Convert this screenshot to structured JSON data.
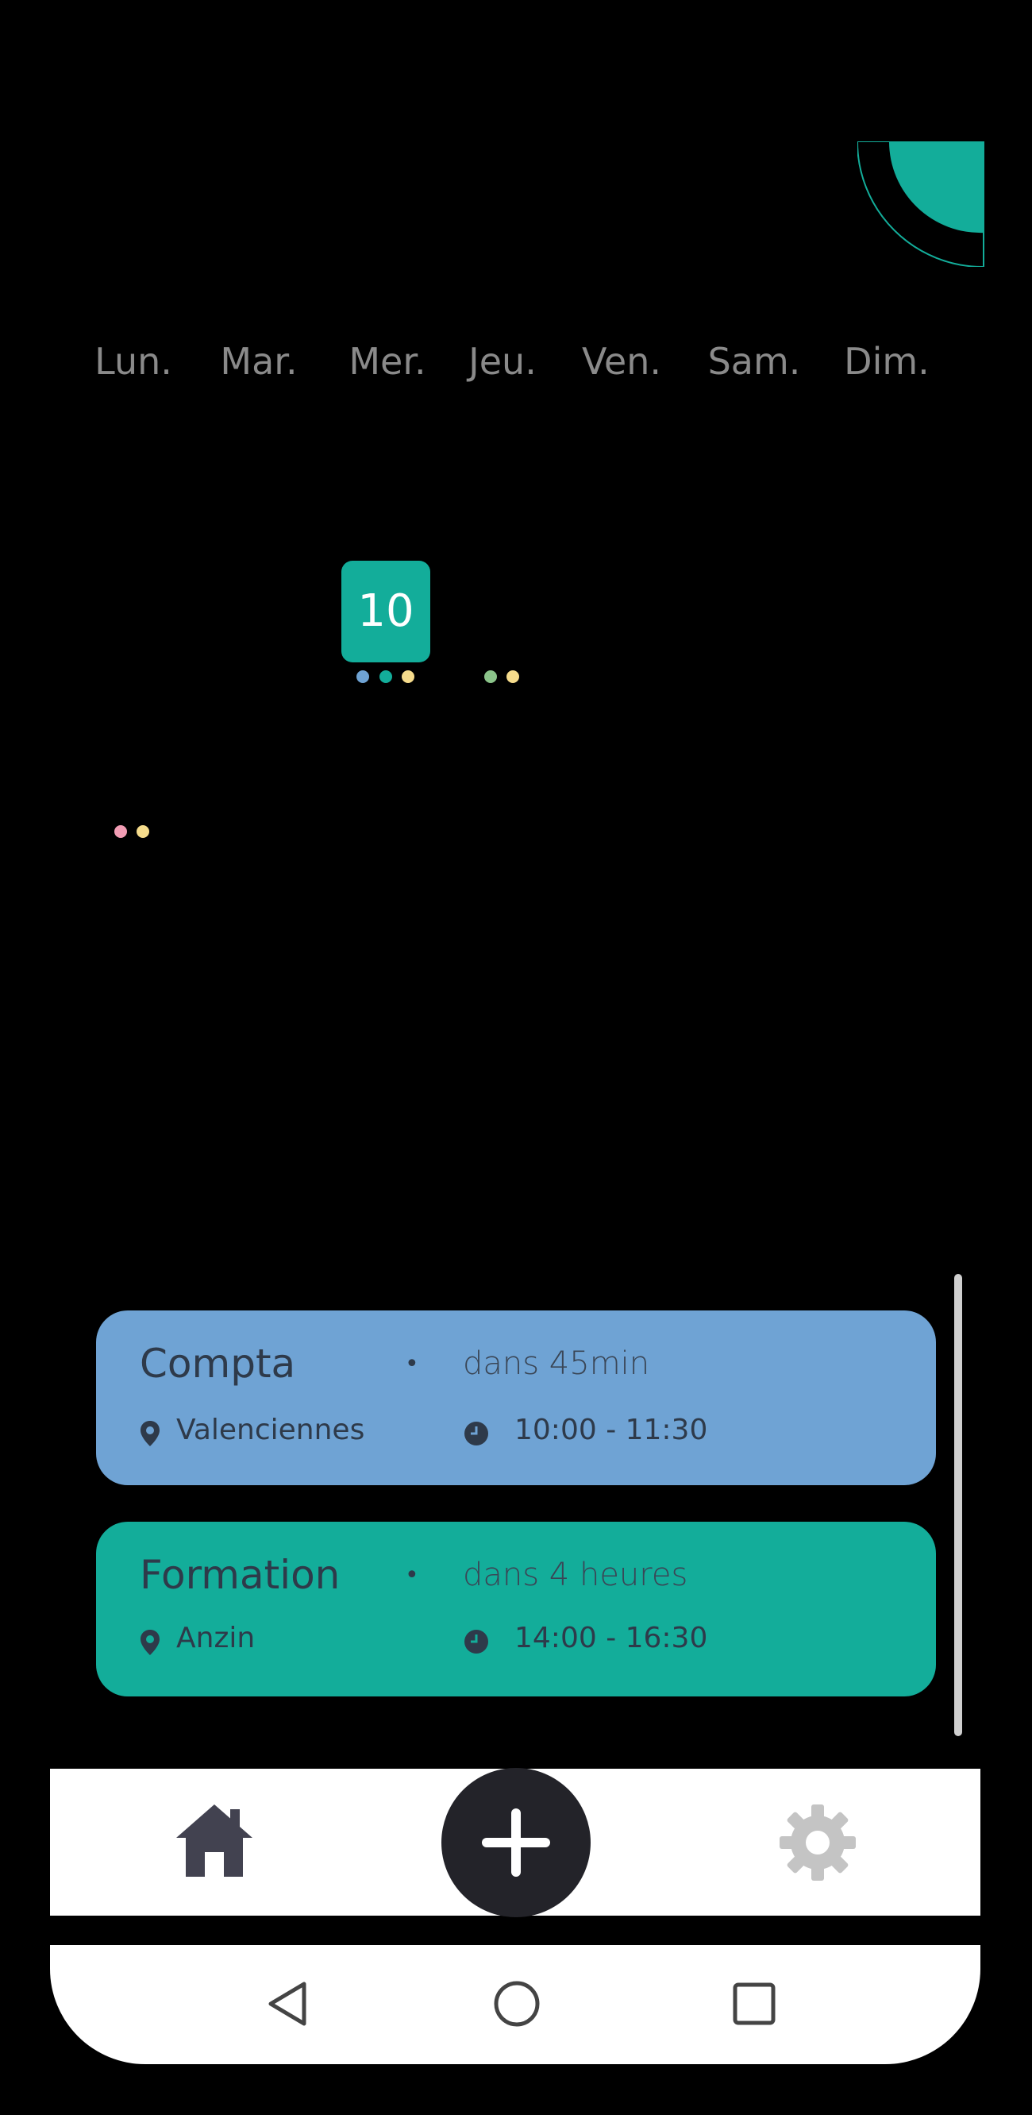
{
  "calendar": {
    "weekdays": [
      "Lun.",
      "Mar.",
      "Mer.",
      "Jeu.",
      "Ven.",
      "Sam.",
      "Dim."
    ],
    "selected_day": "10",
    "dot_colors": {
      "blue": "#6fa3d4",
      "teal": "#13ad9a",
      "yellow": "#f6dc8c",
      "green": "#8bc48a",
      "pink": "#f29db4"
    }
  },
  "events": [
    {
      "title": "Compta",
      "separator": "•",
      "when": "dans 45min",
      "location": "Valenciennes",
      "time": "10:00 - 11:30",
      "color": "#6fa3d4"
    },
    {
      "title": "Formation",
      "separator": "•",
      "when": "dans 4 heures",
      "location": "Anzin",
      "time": "14:00 - 16:30",
      "color": "#13ad9a"
    }
  ],
  "nav": {
    "home_icon": "home-icon",
    "add_icon": "plus-icon",
    "settings_icon": "gear-icon"
  },
  "system_nav": {
    "back_icon": "triangle-back-icon",
    "home_icon": "circle-home-icon",
    "recents_icon": "square-recents-icon"
  },
  "colors": {
    "accent": "#13ad9a",
    "card_blue": "#6fa3d4",
    "dark": "#232329"
  }
}
